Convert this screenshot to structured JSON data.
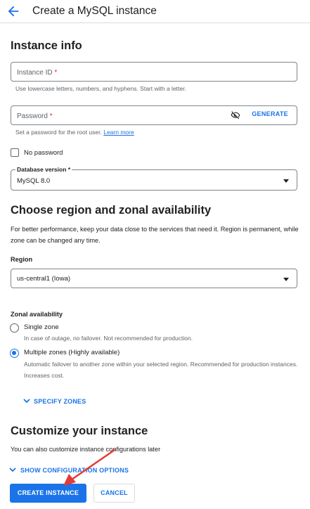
{
  "header": {
    "title": "Create a MySQL instance"
  },
  "instance_info": {
    "title": "Instance info",
    "instance_id": {
      "label": "Instance ID",
      "required_mark": "*",
      "helper": "Use lowercase letters, numbers, and hyphens. Start with a letter."
    },
    "password": {
      "label": "Password",
      "required_mark": "*",
      "generate_label": "GENERATE",
      "helper": "Set a password for the root user.",
      "helper_link": "Learn more"
    },
    "no_password": {
      "label": "No password",
      "checked": false
    },
    "database_version": {
      "label": "Database version",
      "required_mark": "*",
      "value": "MySQL 8.0"
    }
  },
  "region_section": {
    "title": "Choose region and zonal availability",
    "description": "For better performance, keep your data close to the services that need it. Region is permanent, while zone can be changed any time.",
    "region": {
      "label": "Region",
      "value": "us-central1 (Iowa)"
    },
    "zonal": {
      "label": "Zonal availability",
      "options": [
        {
          "label": "Single zone",
          "description": "In case of outage, no failover. Not recommended for production.",
          "selected": false
        },
        {
          "label": "Multiple zones (Highly available)",
          "description": "Automatic failover to another zone within your selected region. Recommended for production instances. Increases cost.",
          "selected": true
        }
      ]
    },
    "specify_zones": "SPECIFY ZONES"
  },
  "customize": {
    "title": "Customize your instance",
    "description": "You can also customize instance configurations later",
    "show_options": "SHOW CONFIGURATION OPTIONS"
  },
  "actions": {
    "create": "CREATE INSTANCE",
    "cancel": "CANCEL"
  },
  "colors": {
    "accent": "#1a73e8",
    "annotation_arrow": "#e53935"
  },
  "icons": {
    "back": "arrow-back-icon",
    "visibility": "visibility-off-icon",
    "expand": "chevron-down-icon",
    "select": "caret-down-icon"
  }
}
